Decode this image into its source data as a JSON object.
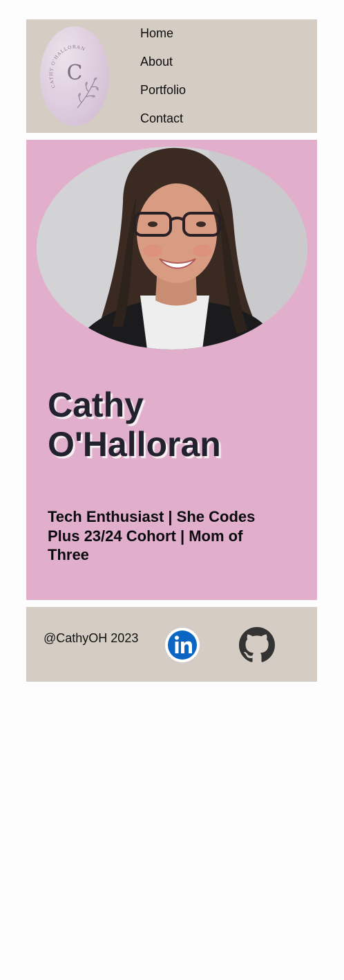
{
  "header": {
    "logo": {
      "icon": "monogram-logo",
      "letter": "C",
      "text": "CATHY O'HALLORAN"
    },
    "nav": [
      {
        "label": "Home"
      },
      {
        "label": "About"
      },
      {
        "label": "Portfolio"
      },
      {
        "label": "Contact"
      }
    ]
  },
  "hero": {
    "photo_icon": "profile-photo",
    "name_line1": "Cathy",
    "name_line2": "O'Halloran",
    "tagline": "Tech Enthusiast | She Codes Plus 23/24 Cohort | Mom of Three"
  },
  "footer": {
    "copyright": "@CathyOH 2023",
    "social": [
      {
        "icon": "linkedin-icon",
        "color": "#0a66c2"
      },
      {
        "icon": "github-icon",
        "color": "#333333"
      }
    ]
  },
  "colors": {
    "header_bg": "#d5ccc4",
    "hero_bg": "#e1afcb",
    "footer_bg": "#d5ccc4",
    "name_color": "#22222f"
  }
}
